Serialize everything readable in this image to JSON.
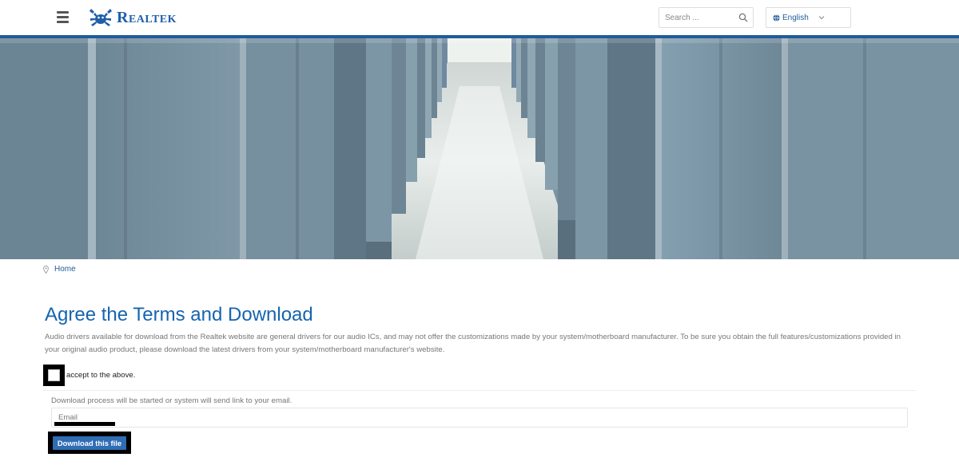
{
  "header": {
    "brand": "Realtek",
    "search_placeholder": "Search ...",
    "language_label": "English"
  },
  "breadcrumb": {
    "home_label": "Home"
  },
  "main": {
    "title": "Agree the Terms and Download",
    "description": "Audio drivers available for download from the Realtek website are general drivers for our audio ICs, and may not offer the customizations made by your system/motherboard manufacturer. To be sure you obtain the full features/customizations provided in your original audio product, please download the latest drivers from your system/motherboard manufacturer's website.",
    "agree_label": "accept to the above.",
    "process_note": "Download process will be started or system will send link to your email.",
    "email_placeholder": "Email",
    "download_button": "Download this file"
  },
  "colors": {
    "brand_blue": "#1f5c99",
    "title_blue": "#1565b0",
    "button_blue": "#2f6db5"
  },
  "icons": [
    "hamburger-icon",
    "realtek-crab-logo",
    "search-icon",
    "globe-icon",
    "chevron-down-icon",
    "map-pin-icon"
  ]
}
